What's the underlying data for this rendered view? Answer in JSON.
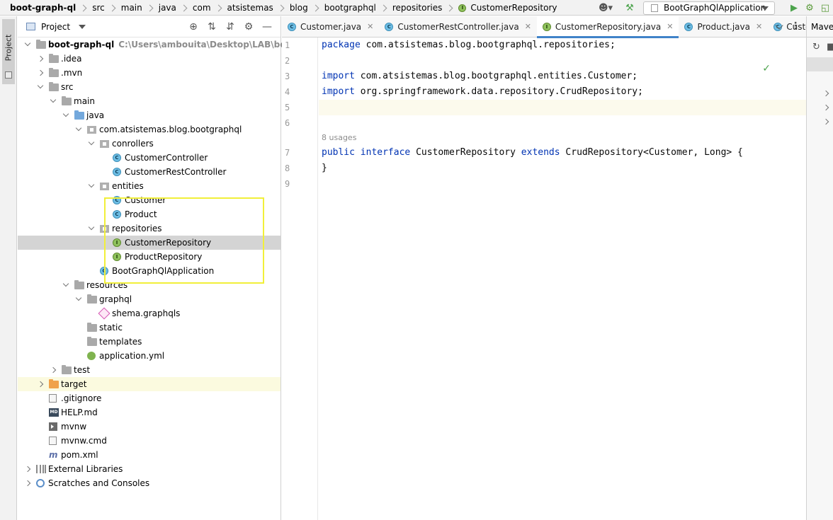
{
  "breadcrumb": [
    "boot-graph-ql",
    "src",
    "main",
    "java",
    "com",
    "atsistemas",
    "blog",
    "bootgraphql",
    "repositories",
    "CustomerRepository"
  ],
  "toolbar": {
    "run_config": "BootGraphQlApplication",
    "user_icon": "user-icon",
    "build_icon": "hammer-icon",
    "run_icon": "run-icon",
    "debug_icon": "debug-icon",
    "coverage_icon": "coverage-icon"
  },
  "left_strip": {
    "project_label": "Project"
  },
  "project_panel": {
    "title": "Project",
    "tools": [
      "locate-icon",
      "expand-all-icon",
      "collapse-all-icon",
      "gear-icon",
      "hide-icon"
    ]
  },
  "tree": [
    {
      "label": "boot-graph-ql",
      "hint": "C:\\Users\\ambouita\\Desktop\\LAB\\boot-graph-",
      "icon": "module-folder",
      "level": 0,
      "arrow": "open",
      "bold": true
    },
    {
      "label": ".idea",
      "icon": "folder",
      "level": 1,
      "arrow": "closed"
    },
    {
      "label": ".mvn",
      "icon": "folder",
      "level": 1,
      "arrow": "closed"
    },
    {
      "label": "src",
      "icon": "folder",
      "level": 1,
      "arrow": "open"
    },
    {
      "label": "main",
      "icon": "folder",
      "level": 2,
      "arrow": "open"
    },
    {
      "label": "java",
      "icon": "source-folder",
      "level": 3,
      "arrow": "open"
    },
    {
      "label": "com.atsistemas.blog.bootgraphql",
      "icon": "package",
      "level": 4,
      "arrow": "open"
    },
    {
      "label": "conrollers",
      "icon": "package",
      "level": 5,
      "arrow": "open"
    },
    {
      "label": "CustomerController",
      "icon": "class",
      "level": 6,
      "arrow": ""
    },
    {
      "label": "CustomerRestController",
      "icon": "class",
      "level": 6,
      "arrow": ""
    },
    {
      "label": "entities",
      "icon": "package",
      "level": 5,
      "arrow": "open"
    },
    {
      "label": "Customer",
      "icon": "class",
      "level": 6,
      "arrow": ""
    },
    {
      "label": "Product",
      "icon": "class",
      "level": 6,
      "arrow": ""
    },
    {
      "label": "repositories",
      "icon": "package",
      "level": 5,
      "arrow": "open"
    },
    {
      "label": "CustomerRepository",
      "icon": "interface",
      "level": 6,
      "arrow": "",
      "selected": true
    },
    {
      "label": "ProductRepository",
      "icon": "interface",
      "level": 6,
      "arrow": ""
    },
    {
      "label": "BootGraphQlApplication",
      "icon": "class",
      "level": 5,
      "arrow": ""
    },
    {
      "label": "resources",
      "icon": "resources-folder",
      "level": 3,
      "arrow": "open"
    },
    {
      "label": "graphql",
      "icon": "folder",
      "level": 4,
      "arrow": "open"
    },
    {
      "label": "shema.graphqls",
      "icon": "graphql-file",
      "level": 5,
      "arrow": ""
    },
    {
      "label": "static",
      "icon": "folder",
      "level": 4,
      "arrow": ""
    },
    {
      "label": "templates",
      "icon": "folder",
      "level": 4,
      "arrow": ""
    },
    {
      "label": "application.yml",
      "icon": "yml-file",
      "level": 4,
      "arrow": ""
    },
    {
      "label": "test",
      "icon": "folder",
      "level": 2,
      "arrow": "closed"
    },
    {
      "label": "target",
      "icon": "excluded-folder",
      "level": 1,
      "arrow": "closed",
      "ignored": true
    },
    {
      "label": ".gitignore",
      "icon": "file",
      "level": 1,
      "arrow": ""
    },
    {
      "label": "HELP.md",
      "icon": "md-file",
      "level": 1,
      "arrow": ""
    },
    {
      "label": "mvnw",
      "icon": "shell-file",
      "level": 1,
      "arrow": ""
    },
    {
      "label": "mvnw.cmd",
      "icon": "file",
      "level": 1,
      "arrow": ""
    },
    {
      "label": "pom.xml",
      "icon": "maven-file",
      "level": 1,
      "arrow": ""
    },
    {
      "label": "External Libraries",
      "icon": "library",
      "level": 0,
      "arrow": "closed"
    },
    {
      "label": "Scratches and Consoles",
      "icon": "scratch",
      "level": 0,
      "arrow": "closed"
    }
  ],
  "editor": {
    "tabs": [
      {
        "label": "Customer.java",
        "icon": "class",
        "active": false
      },
      {
        "label": "CustomerRestController.java",
        "icon": "class",
        "active": false
      },
      {
        "label": "CustomerRepository.java",
        "icon": "interface",
        "active": true
      },
      {
        "label": "Product.java",
        "icon": "class",
        "active": false
      },
      {
        "label": "Custo",
        "icon": "class",
        "active": false
      }
    ],
    "usages_hint": "8 usages",
    "lines": [
      {
        "n": "1",
        "tokens": [
          {
            "t": "package",
            "k": "kw"
          },
          {
            "t": " com.atsistemas.blog.bootgraphql.repositories;",
            "k": ""
          }
        ]
      },
      {
        "n": "2",
        "tokens": []
      },
      {
        "n": "3",
        "tokens": [
          {
            "t": "import",
            "k": "kw"
          },
          {
            "t": " com.atsistemas.blog.bootgraphql.entities.Customer;",
            "k": ""
          }
        ]
      },
      {
        "n": "4",
        "tokens": [
          {
            "t": "import",
            "k": "kw"
          },
          {
            "t": " org.springframework.data.repository.CrudRepository;",
            "k": ""
          }
        ]
      },
      {
        "n": "5",
        "tokens": [],
        "current": true
      },
      {
        "n": "6",
        "tokens": []
      },
      {
        "n": "7",
        "tokens": [
          {
            "t": "public",
            "k": "kw"
          },
          {
            "t": " ",
            "k": ""
          },
          {
            "t": "interface",
            "k": "kw"
          },
          {
            "t": " CustomerRepository ",
            "k": ""
          },
          {
            "t": "extends",
            "k": "kw"
          },
          {
            "t": " CrudRepository<Customer, Long> {",
            "k": ""
          }
        ]
      },
      {
        "n": "8",
        "tokens": [
          {
            "t": "}",
            "k": ""
          }
        ]
      },
      {
        "n": "9",
        "tokens": []
      }
    ]
  },
  "maven_panel": {
    "title": "Maven"
  }
}
